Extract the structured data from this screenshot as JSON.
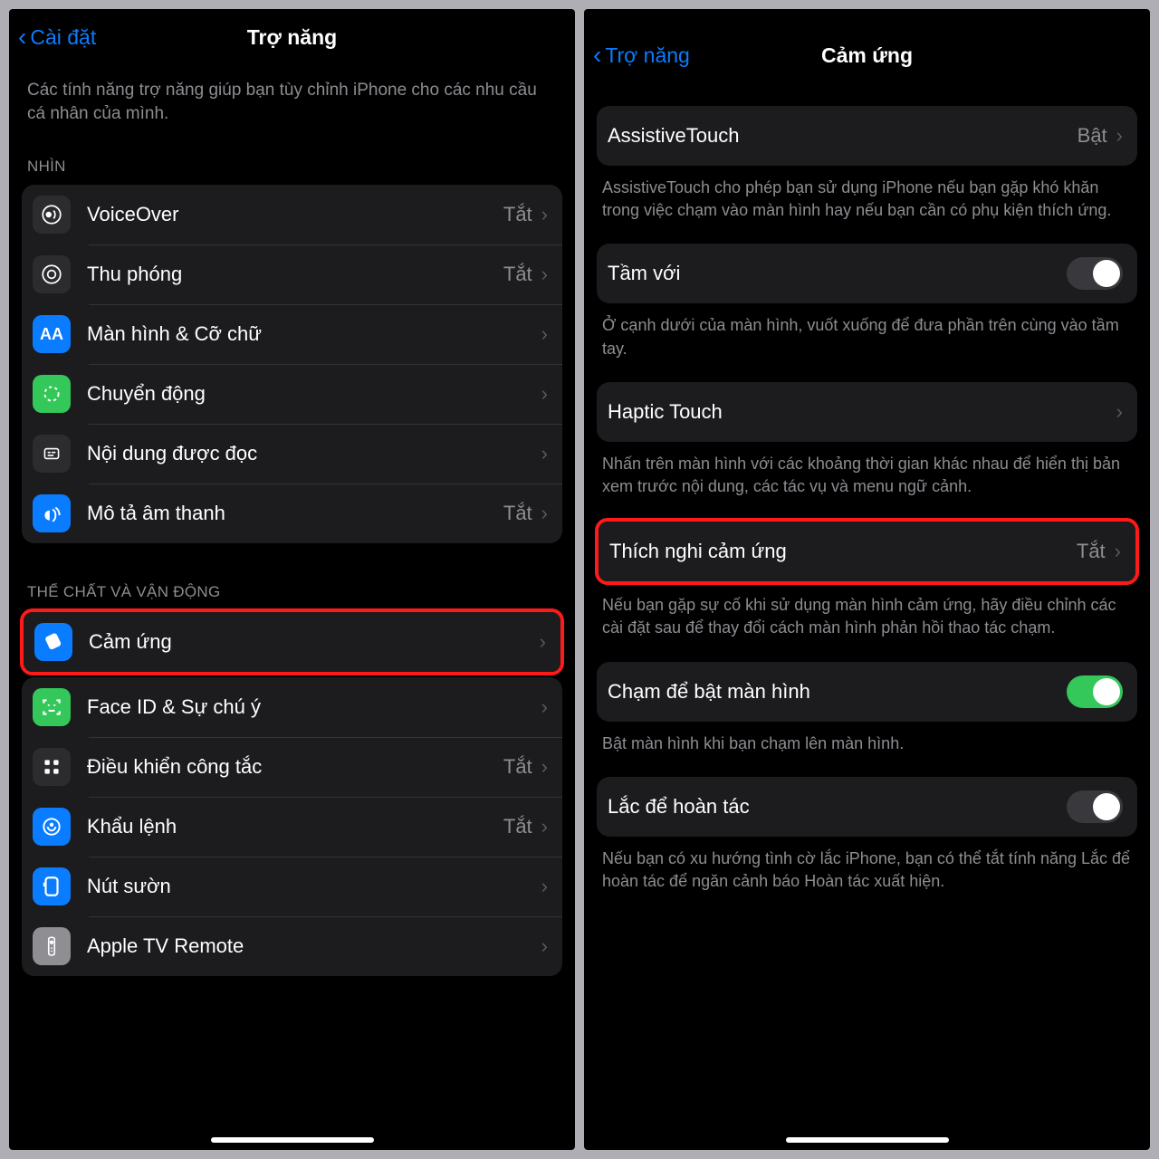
{
  "left": {
    "back_label": "Cài đặt",
    "title": "Trợ năng",
    "intro": "Các tính năng trợ năng giúp bạn tùy chỉnh iPhone cho các nhu cầu cá nhân của mình.",
    "section_vision": "NHÌN",
    "rows1": [
      {
        "label": "VoiceOver",
        "value": "Tắt"
      },
      {
        "label": "Thu phóng",
        "value": "Tắt"
      },
      {
        "label": "Màn hình & Cỡ chữ",
        "value": ""
      },
      {
        "label": "Chuyển động",
        "value": ""
      },
      {
        "label": "Nội dung được đọc",
        "value": ""
      },
      {
        "label": "Mô tả âm thanh",
        "value": "Tắt"
      }
    ],
    "section_motor": "THỂ CHẤT VÀ VẬN ĐỘNG",
    "touch_label": "Cảm ứng",
    "rows2": [
      {
        "label": "Face ID & Sự chú ý",
        "value": ""
      },
      {
        "label": "Điều khiển công tắc",
        "value": "Tắt"
      },
      {
        "label": "Khẩu lệnh",
        "value": "Tắt"
      },
      {
        "label": "Nút sườn",
        "value": ""
      },
      {
        "label": "Apple TV Remote",
        "value": ""
      }
    ]
  },
  "right": {
    "back_label": "Trợ năng",
    "title": "Cảm ứng",
    "assistive": {
      "label": "AssistiveTouch",
      "value": "Bật"
    },
    "assistive_desc": "AssistiveTouch cho phép bạn sử dụng iPhone nếu bạn gặp khó khăn trong việc chạm vào màn hình hay nếu bạn cần có phụ kiện thích ứng.",
    "reach": {
      "label": "Tầm với"
    },
    "reach_desc": "Ở cạnh dưới của màn hình, vuốt xuống để đưa phần trên cùng vào tầm tay.",
    "haptic": {
      "label": "Haptic Touch"
    },
    "haptic_desc": "Nhấn trên màn hình với các khoảng thời gian khác nhau để hiển thị bản xem trước nội dung, các tác vụ và menu ngữ cảnh.",
    "accom": {
      "label": "Thích nghi cảm ứng",
      "value": "Tắt"
    },
    "accom_desc": "Nếu bạn gặp sự cố khi sử dụng màn hình cảm ứng, hãy điều chỉnh các cài đặt sau để thay đổi cách màn hình phản hồi thao tác chạm.",
    "tapwake": {
      "label": "Chạm để bật màn hình"
    },
    "tapwake_desc": "Bật màn hình khi bạn chạm lên màn hình.",
    "shake": {
      "label": "Lắc để hoàn tác"
    },
    "shake_desc": "Nếu bạn có xu hướng tình cờ lắc iPhone, bạn có thể tắt tính năng Lắc để hoàn tác để ngăn cảnh báo Hoàn tác xuất hiện."
  },
  "colors": {
    "blue": "#0a7cff",
    "gray": "#8e8e93",
    "green": "#34c759"
  }
}
